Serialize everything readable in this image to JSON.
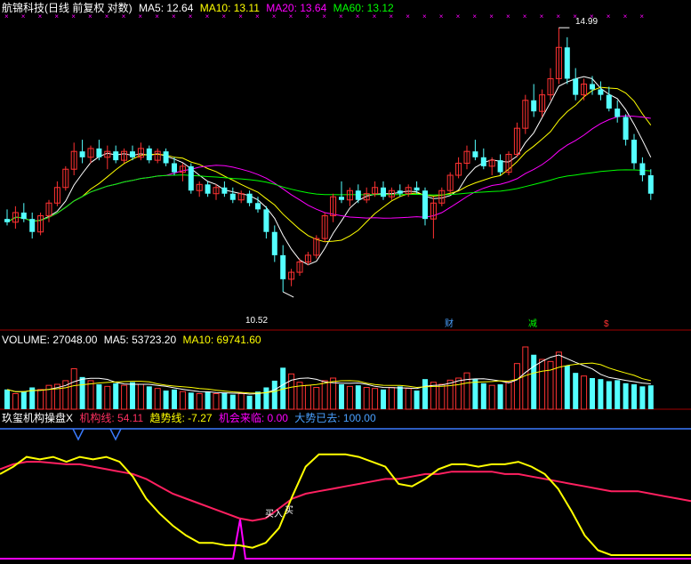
{
  "colors": {
    "bg": "#000000",
    "up": "#ff3232",
    "down": "#54ffff",
    "ma5": "#ffffff",
    "ma10": "#ffff00",
    "ma20": "#ff00ff",
    "ma60": "#00ff00",
    "separator": "#a00000",
    "blue": "#3a7bff",
    "magenta": "#ff00ff",
    "yellow": "#ffff00",
    "red": "#ff2060"
  },
  "price_panel": {
    "stock_name": "航锦科技(日线 前复权 对数)",
    "ma5_label": "MA5: 12.64",
    "ma10_label": "MA10: 13.11",
    "ma20_label": "MA20: 13.64",
    "ma60_label": "MA60: 13.12",
    "high_label": "14.99",
    "low_label": "10.52",
    "markers": {
      "cai": "财",
      "jian": "减",
      "dollar": "$"
    }
  },
  "volume_panel": {
    "volume_label": "VOLUME: 27048.00",
    "ma5_label": "MA5: 53723.20",
    "ma10_label": "MA10: 69741.60"
  },
  "indicator_panel": {
    "name": "玖玺机构操盘X",
    "jigou_label": "机构线: 54.11",
    "qushi_label": "趋势线: -7.27",
    "jihui_label": "机会来临: 0.00",
    "dashi_label": "大势已去: 100.00",
    "buy_label": "买入",
    "buy2_label": "买"
  },
  "chart_data": [
    {
      "type": "candlestick",
      "price_scale": "log",
      "ylim": [
        10.2,
        15.3
      ],
      "candles": [
        [
          11.6,
          11.75,
          11.5,
          11.55
        ],
        [
          11.55,
          11.8,
          11.45,
          11.7
        ],
        [
          11.7,
          11.85,
          11.55,
          11.6
        ],
        [
          11.6,
          11.7,
          11.3,
          11.4
        ],
        [
          11.4,
          11.7,
          11.35,
          11.65
        ],
        [
          11.65,
          11.9,
          11.55,
          11.85
        ],
        [
          11.85,
          12.2,
          11.8,
          12.1
        ],
        [
          12.1,
          12.45,
          12.05,
          12.4
        ],
        [
          12.4,
          12.85,
          12.3,
          12.7
        ],
        [
          12.7,
          12.9,
          12.5,
          12.6
        ],
        [
          12.6,
          12.8,
          12.5,
          12.75
        ],
        [
          12.75,
          12.9,
          12.55,
          12.6
        ],
        [
          12.6,
          12.8,
          12.4,
          12.7
        ],
        [
          12.7,
          12.8,
          12.5,
          12.55
        ],
        [
          12.55,
          12.75,
          12.5,
          12.7
        ],
        [
          12.7,
          12.8,
          12.55,
          12.6
        ],
        [
          12.6,
          12.85,
          12.55,
          12.75
        ],
        [
          12.75,
          12.8,
          12.5,
          12.55
        ],
        [
          12.55,
          12.75,
          12.5,
          12.7
        ],
        [
          12.7,
          12.75,
          12.45,
          12.5
        ],
        [
          12.5,
          12.6,
          12.3,
          12.35
        ],
        [
          12.35,
          12.5,
          12.2,
          12.45
        ],
        [
          12.45,
          12.5,
          12.0,
          12.05
        ],
        [
          12.05,
          12.2,
          11.95,
          12.15
        ],
        [
          12.15,
          12.2,
          11.95,
          12.0
        ],
        [
          12.0,
          12.15,
          11.9,
          12.1
        ],
        [
          12.1,
          12.2,
          11.95,
          12.0
        ],
        [
          12.0,
          12.1,
          11.85,
          11.9
        ],
        [
          11.9,
          12.05,
          11.85,
          12.0
        ],
        [
          12.0,
          12.05,
          11.8,
          11.85
        ],
        [
          11.85,
          11.95,
          11.7,
          11.75
        ],
        [
          11.75,
          11.8,
          11.3,
          11.4
        ],
        [
          11.4,
          11.5,
          10.95,
          11.05
        ],
        [
          11.05,
          11.2,
          10.52,
          10.7
        ],
        [
          10.7,
          10.85,
          10.6,
          10.8
        ],
        [
          10.8,
          11.0,
          10.75,
          10.95
        ],
        [
          10.95,
          11.1,
          10.9,
          11.05
        ],
        [
          11.05,
          11.35,
          11.0,
          11.3
        ],
        [
          11.3,
          11.7,
          11.25,
          11.65
        ],
        [
          11.65,
          12.0,
          11.55,
          11.95
        ],
        [
          11.95,
          12.2,
          11.85,
          11.9
        ],
        [
          11.9,
          12.1,
          11.8,
          12.05
        ],
        [
          12.05,
          12.15,
          11.85,
          11.9
        ],
        [
          11.9,
          12.1,
          11.85,
          12.0
        ],
        [
          12.0,
          12.2,
          11.95,
          12.1
        ],
        [
          12.1,
          12.2,
          11.9,
          11.95
        ],
        [
          11.95,
          12.1,
          11.9,
          12.05
        ],
        [
          12.05,
          12.15,
          11.95,
          12.0
        ],
        [
          12.0,
          12.15,
          11.95,
          12.1
        ],
        [
          12.1,
          12.2,
          12.0,
          12.05
        ],
        [
          12.05,
          12.1,
          11.5,
          11.6
        ],
        [
          11.6,
          11.95,
          11.3,
          11.85
        ],
        [
          11.85,
          12.1,
          11.8,
          12.05
        ],
        [
          12.05,
          12.35,
          12.0,
          12.3
        ],
        [
          12.3,
          12.6,
          12.25,
          12.5
        ],
        [
          12.5,
          12.8,
          12.4,
          12.7
        ],
        [
          12.7,
          12.9,
          12.55,
          12.6
        ],
        [
          12.6,
          12.75,
          12.4,
          12.45
        ],
        [
          12.45,
          12.6,
          12.3,
          12.55
        ],
        [
          12.55,
          12.65,
          12.3,
          12.35
        ],
        [
          12.35,
          12.7,
          12.3,
          12.65
        ],
        [
          12.65,
          13.2,
          12.6,
          13.1
        ],
        [
          13.1,
          13.7,
          13.0,
          13.6
        ],
        [
          13.6,
          13.9,
          13.3,
          13.4
        ],
        [
          13.4,
          13.8,
          13.3,
          13.7
        ],
        [
          13.7,
          14.2,
          13.6,
          14.0
        ],
        [
          14.0,
          14.99,
          13.9,
          14.6
        ],
        [
          14.6,
          14.8,
          13.9,
          14.0
        ],
        [
          14.0,
          14.2,
          13.6,
          13.7
        ],
        [
          13.7,
          14.0,
          13.6,
          13.9
        ],
        [
          13.9,
          14.05,
          13.7,
          13.8
        ],
        [
          13.8,
          13.95,
          13.6,
          13.7
        ],
        [
          13.7,
          13.85,
          13.4,
          13.45
        ],
        [
          13.45,
          13.6,
          13.2,
          13.3
        ],
        [
          13.3,
          13.35,
          12.8,
          12.9
        ],
        [
          12.9,
          13.0,
          12.4,
          12.5
        ],
        [
          12.5,
          12.6,
          12.2,
          12.3
        ],
        [
          12.3,
          12.4,
          11.9,
          12.0
        ]
      ]
    },
    {
      "type": "bar",
      "series_name": "VOLUME",
      "values": [
        38,
        30,
        34,
        42,
        38,
        46,
        48,
        55,
        78,
        62,
        55,
        48,
        44,
        50,
        46,
        52,
        48,
        44,
        40,
        36,
        38,
        34,
        32,
        30,
        34,
        30,
        32,
        28,
        30,
        26,
        34,
        42,
        55,
        80,
        68,
        52,
        46,
        42,
        55,
        60,
        48,
        44,
        46,
        42,
        40,
        38,
        42,
        44,
        40,
        36,
        58,
        52,
        48,
        56,
        60,
        70,
        58,
        50,
        46,
        48,
        52,
        88,
        120,
        105,
        96,
        92,
        110,
        84,
        70,
        64,
        60,
        58,
        54,
        56,
        50,
        48,
        44,
        46
      ]
    },
    {
      "type": "line",
      "series": [
        {
          "name": "机构线",
          "values": [
            70,
            74,
            76,
            76,
            75,
            74,
            74,
            72,
            70,
            68,
            66,
            62,
            56,
            50,
            46,
            42,
            38,
            34,
            30,
            28,
            30,
            38,
            46,
            50,
            52,
            54,
            56,
            58,
            60,
            62,
            62,
            64,
            66,
            66,
            68,
            68,
            68,
            68,
            66,
            66,
            64,
            62,
            60,
            58,
            56,
            54,
            52,
            52,
            52,
            50,
            48,
            46,
            44
          ]
        },
        {
          "name": "趋势线",
          "values": [
            66,
            72,
            80,
            78,
            80,
            76,
            80,
            78,
            80,
            76,
            64,
            46,
            34,
            24,
            16,
            10,
            10,
            8,
            8,
            6,
            10,
            22,
            48,
            72,
            82,
            82,
            82,
            80,
            76,
            72,
            58,
            56,
            62,
            70,
            74,
            74,
            72,
            74,
            74,
            76,
            72,
            66,
            54,
            36,
            16,
            4,
            0,
            0,
            0,
            0,
            0,
            0,
            0
          ]
        }
      ]
    }
  ]
}
